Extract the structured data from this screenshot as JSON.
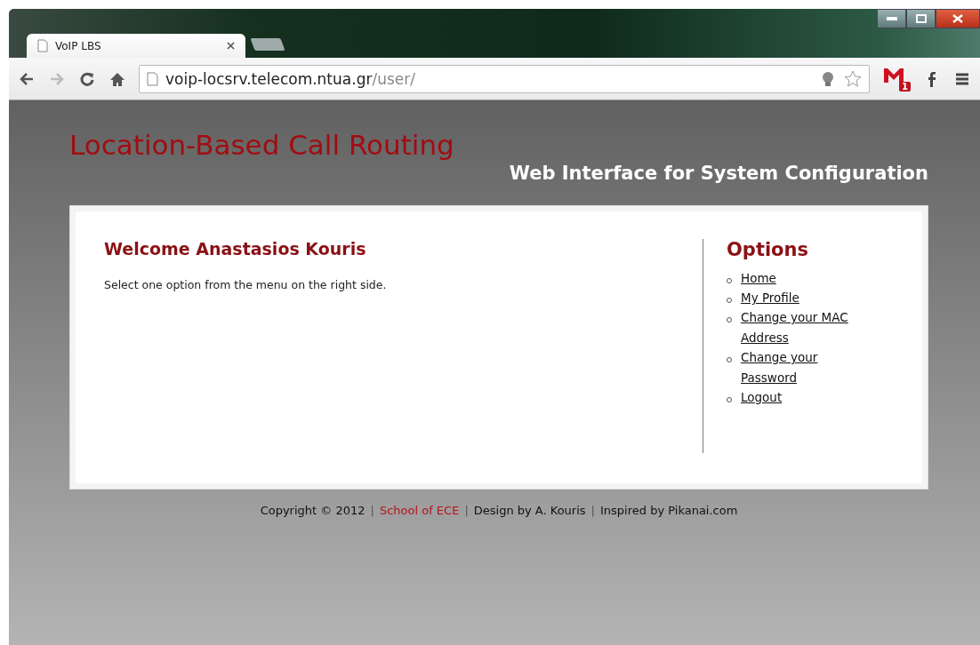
{
  "browser": {
    "tab": {
      "title": "VoIP LBS",
      "selected": true
    },
    "address": {
      "host": "voip-locsrv.telecom.ntua.gr",
      "path": "/user/"
    },
    "mail_badge": "1"
  },
  "header": {
    "title": "Location-Based Call Routing",
    "subtitle": "Web Interface for System Configuration"
  },
  "main": {
    "heading": "Welcome Anastasios Kouris",
    "text": "Select one option from the menu on the right side."
  },
  "options": {
    "heading": "Options",
    "items": [
      {
        "label": "Home"
      },
      {
        "label": "My Profile"
      },
      {
        "label": "Change your MAC Address"
      },
      {
        "label": "Change your Password"
      },
      {
        "label": "Logout"
      }
    ]
  },
  "footer": [
    {
      "kind": "text",
      "text": "Copyright © 2012"
    },
    {
      "kind": "separator",
      "text": "|"
    },
    {
      "kind": "link",
      "text": "School of ECE"
    },
    {
      "kind": "separator",
      "text": "|"
    },
    {
      "kind": "text",
      "text": "Design by A. Kouris"
    },
    {
      "kind": "separator",
      "text": "|"
    },
    {
      "kind": "text",
      "text": "Inspired by Pikanai.com"
    }
  ]
}
